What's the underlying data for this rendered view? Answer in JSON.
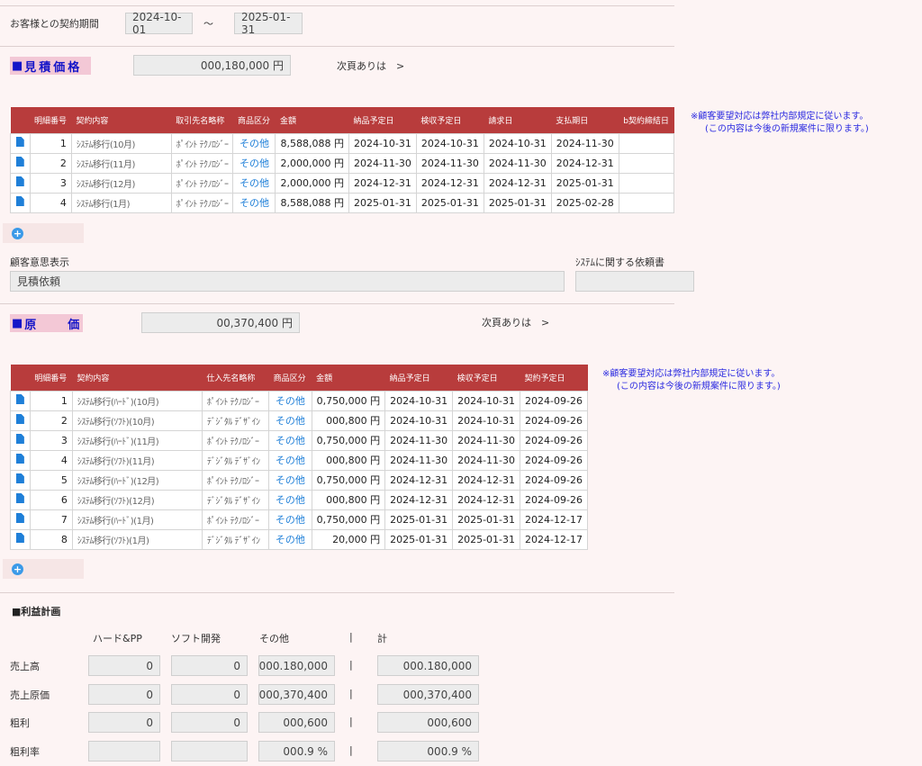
{
  "contract": {
    "label": "お客様との契約期間",
    "start": "2024-10-01",
    "tilde": "～",
    "end": "2025-01-31"
  },
  "estimate": {
    "title_sq": "■",
    "title": "見積価格",
    "amount": "000,180,000 円",
    "next_link": "次頁ありは　>",
    "note_line1": "※顧客要望対応は弊社内部規定に従います。",
    "note_line2": "(この内容は今後の新規案件に限ります。)",
    "headers": [
      "",
      "明細番号",
      "契約内容",
      "取引先名略称",
      "商品区分",
      "金額",
      "納品予定日",
      "検収予定日",
      "請求日",
      "支払期日",
      "b契約締結日"
    ],
    "rows": [
      {
        "no": "1",
        "content": "ｼｽﾃﾑ移行(10月)",
        "partner": "ﾎﾟｲﾝﾄ ﾃｸﾉﾛｼﾞｰ",
        "category": "その他",
        "amount": "8,588,088 円",
        "delivery": "2024-10-31",
        "inspection": "2024-10-31",
        "billing": "2024-10-31",
        "payment": "2024-11-30",
        "signed": ""
      },
      {
        "no": "2",
        "content": "ｼｽﾃﾑ移行(11月)",
        "partner": "ﾎﾟｲﾝﾄ ﾃｸﾉﾛｼﾞｰ",
        "category": "その他",
        "amount": "2,000,000 円",
        "delivery": "2024-11-30",
        "inspection": "2024-11-30",
        "billing": "2024-11-30",
        "payment": "2024-12-31",
        "signed": ""
      },
      {
        "no": "3",
        "content": "ｼｽﾃﾑ移行(12月)",
        "partner": "ﾎﾟｲﾝﾄ ﾃｸﾉﾛｼﾞｰ",
        "category": "その他",
        "amount": "2,000,000 円",
        "delivery": "2024-12-31",
        "inspection": "2024-12-31",
        "billing": "2024-12-31",
        "payment": "2025-01-31",
        "signed": ""
      },
      {
        "no": "4",
        "content": "ｼｽﾃﾑ移行(1月)",
        "partner": "ﾎﾟｲﾝﾄ ﾃｸﾉﾛｼﾞｰ",
        "category": "その他",
        "amount": "8,588,088 円",
        "delivery": "2025-01-31",
        "inspection": "2025-01-31",
        "billing": "2025-01-31",
        "payment": "2025-02-28",
        "signed": ""
      }
    ]
  },
  "intent": {
    "label": "顧客意思表示",
    "value": "見積依頼",
    "request_label": "ｼｽﾃﾑに関する依頼書",
    "request_value": ""
  },
  "cost": {
    "title_sq": "■",
    "title": "原　　価",
    "amount": "00,370,400 円",
    "next_link": "次頁ありは　>",
    "note_line1": "※顧客要望対応は弊社内部規定に従います。",
    "note_line2": "(この内容は今後の新規案件に限ります。)",
    "headers": [
      "",
      "明細番号",
      "契約内容",
      "仕入先名略称",
      "商品区分",
      "金額",
      "納品予定日",
      "検収予定日",
      "契約予定日"
    ],
    "rows": [
      {
        "no": "1",
        "content": "ｼｽﾃﾑ移行(ﾊｰﾄﾞ)(10月)",
        "supplier": "ﾎﾟｲﾝﾄ ﾃｸﾉﾛｼﾞｰ",
        "category": "その他",
        "amount": "0,750,000 円",
        "delivery": "2024-10-31",
        "inspection": "2024-10-31",
        "contract": "2024-09-26"
      },
      {
        "no": "2",
        "content": "ｼｽﾃﾑ移行(ｿﾌﾄ)(10月)",
        "supplier": "ﾃﾞｼﾞﾀﾙ ﾃﾞｻﾞｲﾝ",
        "category": "その他",
        "amount": "000,800 円",
        "delivery": "2024-10-31",
        "inspection": "2024-10-31",
        "contract": "2024-09-26"
      },
      {
        "no": "3",
        "content": "ｼｽﾃﾑ移行(ﾊｰﾄﾞ)(11月)",
        "supplier": "ﾎﾟｲﾝﾄ ﾃｸﾉﾛｼﾞｰ",
        "category": "その他",
        "amount": "0,750,000 円",
        "delivery": "2024-11-30",
        "inspection": "2024-11-30",
        "contract": "2024-09-26"
      },
      {
        "no": "4",
        "content": "ｼｽﾃﾑ移行(ｿﾌﾄ)(11月)",
        "supplier": "ﾃﾞｼﾞﾀﾙ ﾃﾞｻﾞｲﾝ",
        "category": "その他",
        "amount": "000,800 円",
        "delivery": "2024-11-30",
        "inspection": "2024-11-30",
        "contract": "2024-09-26"
      },
      {
        "no": "5",
        "content": "ｼｽﾃﾑ移行(ﾊｰﾄﾞ)(12月)",
        "supplier": "ﾎﾟｲﾝﾄ ﾃｸﾉﾛｼﾞｰ",
        "category": "その他",
        "amount": "0,750,000 円",
        "delivery": "2024-12-31",
        "inspection": "2024-12-31",
        "contract": "2024-09-26"
      },
      {
        "no": "6",
        "content": "ｼｽﾃﾑ移行(ｿﾌﾄ)(12月)",
        "supplier": "ﾃﾞｼﾞﾀﾙ ﾃﾞｻﾞｲﾝ",
        "category": "その他",
        "amount": "000,800 円",
        "delivery": "2024-12-31",
        "inspection": "2024-12-31",
        "contract": "2024-09-26"
      },
      {
        "no": "7",
        "content": "ｼｽﾃﾑ移行(ﾊｰﾄﾞ)(1月)",
        "supplier": "ﾎﾟｲﾝﾄ ﾃｸﾉﾛｼﾞｰ",
        "category": "その他",
        "amount": "0,750,000 円",
        "delivery": "2025-01-31",
        "inspection": "2025-01-31",
        "contract": "2024-12-17"
      },
      {
        "no": "8",
        "content": "ｼｽﾃﾑ移行(ｿﾌﾄ)(1月)",
        "supplier": "ﾃﾞｼﾞﾀﾙ ﾃﾞｻﾞｲﾝ",
        "category": "その他",
        "amount": "20,000 円",
        "delivery": "2025-01-31",
        "inspection": "2025-01-31",
        "contract": "2024-12-17"
      }
    ]
  },
  "profit": {
    "title": "■利益計画",
    "col_hard": "ハード&PP",
    "col_soft": "ソフト開発",
    "col_other": "その他",
    "col_sep": "|",
    "col_total": "計",
    "rows": [
      {
        "label": "売上高",
        "hard": "0",
        "soft": "0",
        "other": "000.180,000",
        "total": "000.180,000"
      },
      {
        "label": "売上原価",
        "hard": "0",
        "soft": "0",
        "other": "000,370,400",
        "total": "000,370,400"
      },
      {
        "label": "粗利",
        "hard": "0",
        "soft": "0",
        "other": "000,600",
        "total": "000,600"
      },
      {
        "label": "粗利率",
        "hard": "",
        "soft": "",
        "other": "000.9 %",
        "total": "000.9 %"
      }
    ]
  },
  "icons": {
    "doc": "document-icon",
    "add": "plus-circle-icon",
    "add_glyph": "+"
  },
  "colors": {
    "header_bg": "#b83c3c",
    "title_bg": "#f3c8d6",
    "title_text": "#1515c8",
    "link_blue": "#1e7fd8"
  }
}
